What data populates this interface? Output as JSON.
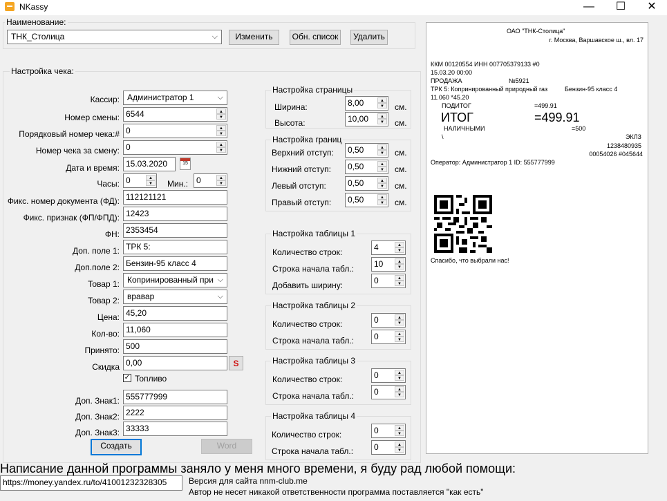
{
  "window": {
    "title": "NKassy",
    "minimize": "—",
    "maximize": "☐",
    "close": "✕"
  },
  "name_group": {
    "label": "Наименование:",
    "value": "ТНК_Столица",
    "edit": "Изменить",
    "refresh": "Обн. список",
    "delete": "Удалить"
  },
  "check": {
    "label": "Настройка чека:",
    "cashier": {
      "label": "Кассир:",
      "value": "Администратор 1"
    },
    "shift": {
      "label": "Номер смены:",
      "value": "6544"
    },
    "seq": {
      "label": "Порядковый номер чека:#",
      "value": "0"
    },
    "shift_check": {
      "label": "Номер чека за смену:",
      "value": "0"
    },
    "date": {
      "label": "Дата и время:",
      "value": "15.03.2020",
      "cal": "15"
    },
    "hours": {
      "label": "Часы:",
      "value": "0"
    },
    "minutes": {
      "label": "Мин.:",
      "value": "0"
    },
    "fd": {
      "label": "Фикс. номер документа (ФД):",
      "value": "112121121"
    },
    "fp": {
      "label": "Фикс. признак (ФП/ФПД):",
      "value": "12423"
    },
    "fn": {
      "label": "ФН:",
      "value": "2353454"
    },
    "extra1": {
      "label": "Доп. поле 1:",
      "value": "ТРК 5:"
    },
    "extra2": {
      "label": "Доп.поле 2:",
      "value": "Бензин-95 класс 4"
    },
    "item1": {
      "label": "Товар 1:",
      "value": "Копринированный при"
    },
    "item2": {
      "label": "Товар 2:",
      "value": "вравар"
    },
    "price": {
      "label": "Цена:",
      "value": "45,20"
    },
    "qty": {
      "label": "Кол-во:",
      "value": "11,060"
    },
    "accepted": {
      "label": "Принято:",
      "value": "500"
    },
    "discount": {
      "label": "Скидка",
      "value": "0,00",
      "s": "S"
    },
    "fuel": {
      "label": "Топливо",
      "checked": true
    },
    "sign1": {
      "label": "Доп. Знак1:",
      "value": "555777999"
    },
    "sign2": {
      "label": "Доп. Знак2:",
      "value": "2222"
    },
    "sign3": {
      "label": "Доп. Знак3:",
      "value": "33333"
    },
    "create": "Создать",
    "word": "Word"
  },
  "page_settings": {
    "label": "Настройка страницы",
    "width": {
      "label": "Ширина:",
      "value": "8,00",
      "unit": "см."
    },
    "height": {
      "label": "Высота:",
      "value": "10,00",
      "unit": "см."
    }
  },
  "margins": {
    "label": "Настройка границ",
    "top": {
      "label": "Верхний отступ:",
      "value": "0,50",
      "unit": "см."
    },
    "bottom": {
      "label": "Нижний отступ:",
      "value": "0,50",
      "unit": "см."
    },
    "left": {
      "label": "Левый отступ:",
      "value": "0,50",
      "unit": "см."
    },
    "right": {
      "label": "Правый отступ:",
      "value": "0,50",
      "unit": "см."
    }
  },
  "table1": {
    "label": "Настройка таблицы 1",
    "rows": {
      "label": "Количество строк:",
      "value": "4"
    },
    "start": {
      "label": "Строка начала табл.:",
      "value": "10"
    },
    "width": {
      "label": "Добавить ширину:",
      "value": "0"
    }
  },
  "table2": {
    "label": "Настройка таблицы 2",
    "rows": {
      "label": "Количество строк:",
      "value": "0"
    },
    "start": {
      "label": "Строка начала табл.:",
      "value": "0"
    }
  },
  "table3": {
    "label": "Настройка таблицы 3",
    "rows": {
      "label": "Количество строк:",
      "value": "0"
    },
    "start": {
      "label": "Строка начала табл.:",
      "value": "0"
    }
  },
  "table4": {
    "label": "Настройка таблицы 4",
    "rows": {
      "label": "Количество строк:",
      "value": "0"
    },
    "start": {
      "label": "Строка начала табл.:",
      "value": "0"
    }
  },
  "receipt": {
    "company": "ОАО \"ТНК-Столица\"",
    "address": "г. Москва, Варшавское ш., вл. 17",
    "kkm": "ККМ 00120554 ИНН 007705379133    #0",
    "datetime": "15.03.20 00:00",
    "sale": "ПРОДАЖА",
    "sale_no": "№5921",
    "trk": "ТРК 5: Копринированный природный газ",
    "fuel": "Бензин-95 класс 4",
    "qty_price": "11.060     *45.20",
    "subtotal_label": "ПОДИТОГ",
    "subtotal": "=499.91",
    "total_label": "ИТОГ",
    "total": "=499.91",
    "cash_label": "НАЛИЧНЫМИ",
    "cash": "=500",
    "backslash": "\\",
    "eklz": "ЭКЛЗ",
    "eklz_no": "1238480935",
    "eklz_code": "00054026 #045644",
    "operator": "Оператор: Администратор 1 ID:     555777999",
    "thanks": "Спасибо, что выбрали нас!"
  },
  "footer": {
    "headline": "Написание данной программы заняло у меня много времени, я буду рад любой помощи:",
    "link": "https://money.yandex.ru/to/41001232328305",
    "version": "Версия для сайта nnm-club.me",
    "disclaimer": "Автор не несет никакой ответственности программа поставляется \"как есть\""
  }
}
